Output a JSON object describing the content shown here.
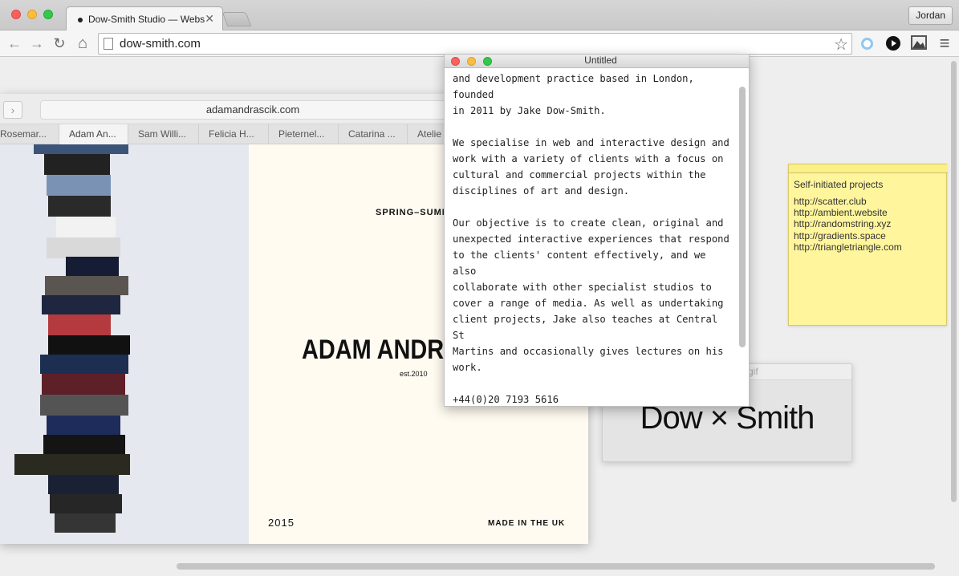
{
  "browser": {
    "tab_title": "Dow-Smith Studio — Website",
    "tab_close": "✕",
    "profile": "Jordan",
    "url": "dow-smith.com",
    "back_icon": "←",
    "forward_icon": "→",
    "reload_icon": "↻",
    "home_icon": "⌂",
    "star_icon": "☆",
    "menu_icon": "≡"
  },
  "inner_browser": {
    "forward_icon": "›",
    "url": "adamandrascik.com",
    "tabs": [
      "Rosemar...",
      "Adam An...",
      "Sam Willi...",
      "Felicia H...",
      "Pieternel...",
      "Catarina ...",
      "Atelie"
    ],
    "active_tab_index": 1
  },
  "poster": {
    "season": "SPRING–SUMMER",
    "brand": "ADAM ANDRASCIK",
    "est": "est.2010",
    "year": "2015",
    "made": "MADE IN THE UK"
  },
  "editor": {
    "title": "Untitled",
    "text": "and development practice based in London, founded\nin 2011 by Jake Dow-Smith.\n\nWe specialise in web and interactive design and\nwork with a variety of clients with a focus on\ncultural and commercial projects within the\ndisciplines of art and design.\n\nOur objective is to create clean, original and\nunexpected interactive experiences that respond\nto the clients' content effectively, and we also\ncollaborate with other specialist studios to\ncover a range of media. As well as undertaking\nclient projects, Jake also teaches at Central St\nMartins and occasionally gives lectures on his\nwork.\n\n+44(0)20 7193 5616\nstudio@dow-smith.com\n@jakedowsmith"
  },
  "sticky": {
    "title": "Self-initiated projects",
    "links": [
      "http://scatter.club",
      "http://ambient.website",
      "http://randomstring.xyz",
      "http://gradients.space",
      "http://triangletriangle.com"
    ]
  },
  "gif_card": {
    "ext": "gif",
    "logo": "Dow × Smith"
  }
}
